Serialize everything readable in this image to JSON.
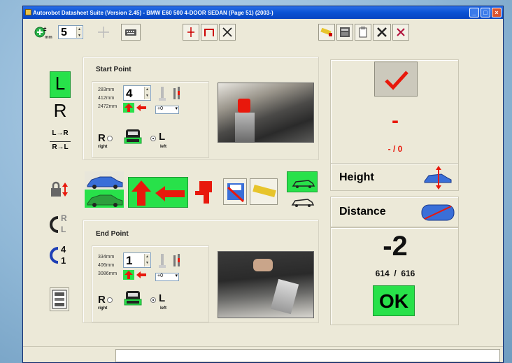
{
  "window": {
    "title": "Autorobot Datasheet Suite (Version 2.45) - BMW E60 500 4-DOOR SEDAN (Page 51) (2003-)",
    "controls": [
      "_",
      "□",
      "×"
    ]
  },
  "toolbar": {
    "tolerance_unit": "mm",
    "tolerance_value": "5"
  },
  "start_point": {
    "title": "Start Point",
    "measures": [
      "283mm",
      "412mm",
      "2472mm"
    ],
    "point_number": "4",
    "offset": "+0",
    "side_right": "R",
    "side_right_sub": "right",
    "side_left": "L",
    "side_left_sub": "left",
    "selected_side": "left"
  },
  "end_point": {
    "title": "End Point",
    "measures": [
      "334mm",
      "406mm",
      "3086mm"
    ],
    "point_number": "1",
    "offset": "+0",
    "side_right": "R",
    "side_right_sub": "right",
    "side_left": "L",
    "side_left_sub": "left",
    "selected_side": "left"
  },
  "side_selector": {
    "left": "L",
    "right": "R",
    "l_to_r": "L→R",
    "r_to_l": "R→L",
    "swap_top": "R",
    "swap_bottom": "L",
    "num_top": "4",
    "num_bottom": "1"
  },
  "result": {
    "height_value": "-",
    "height_sub": "- / 0",
    "height_label": "Height",
    "distance_label": "Distance",
    "distance_value": "-2",
    "distance_sub": "614  /  616",
    "status": "OK"
  },
  "colors": {
    "ok_green": "#28e14a",
    "accent_red": "#e8180c",
    "title_blue": "#0a52d4"
  }
}
